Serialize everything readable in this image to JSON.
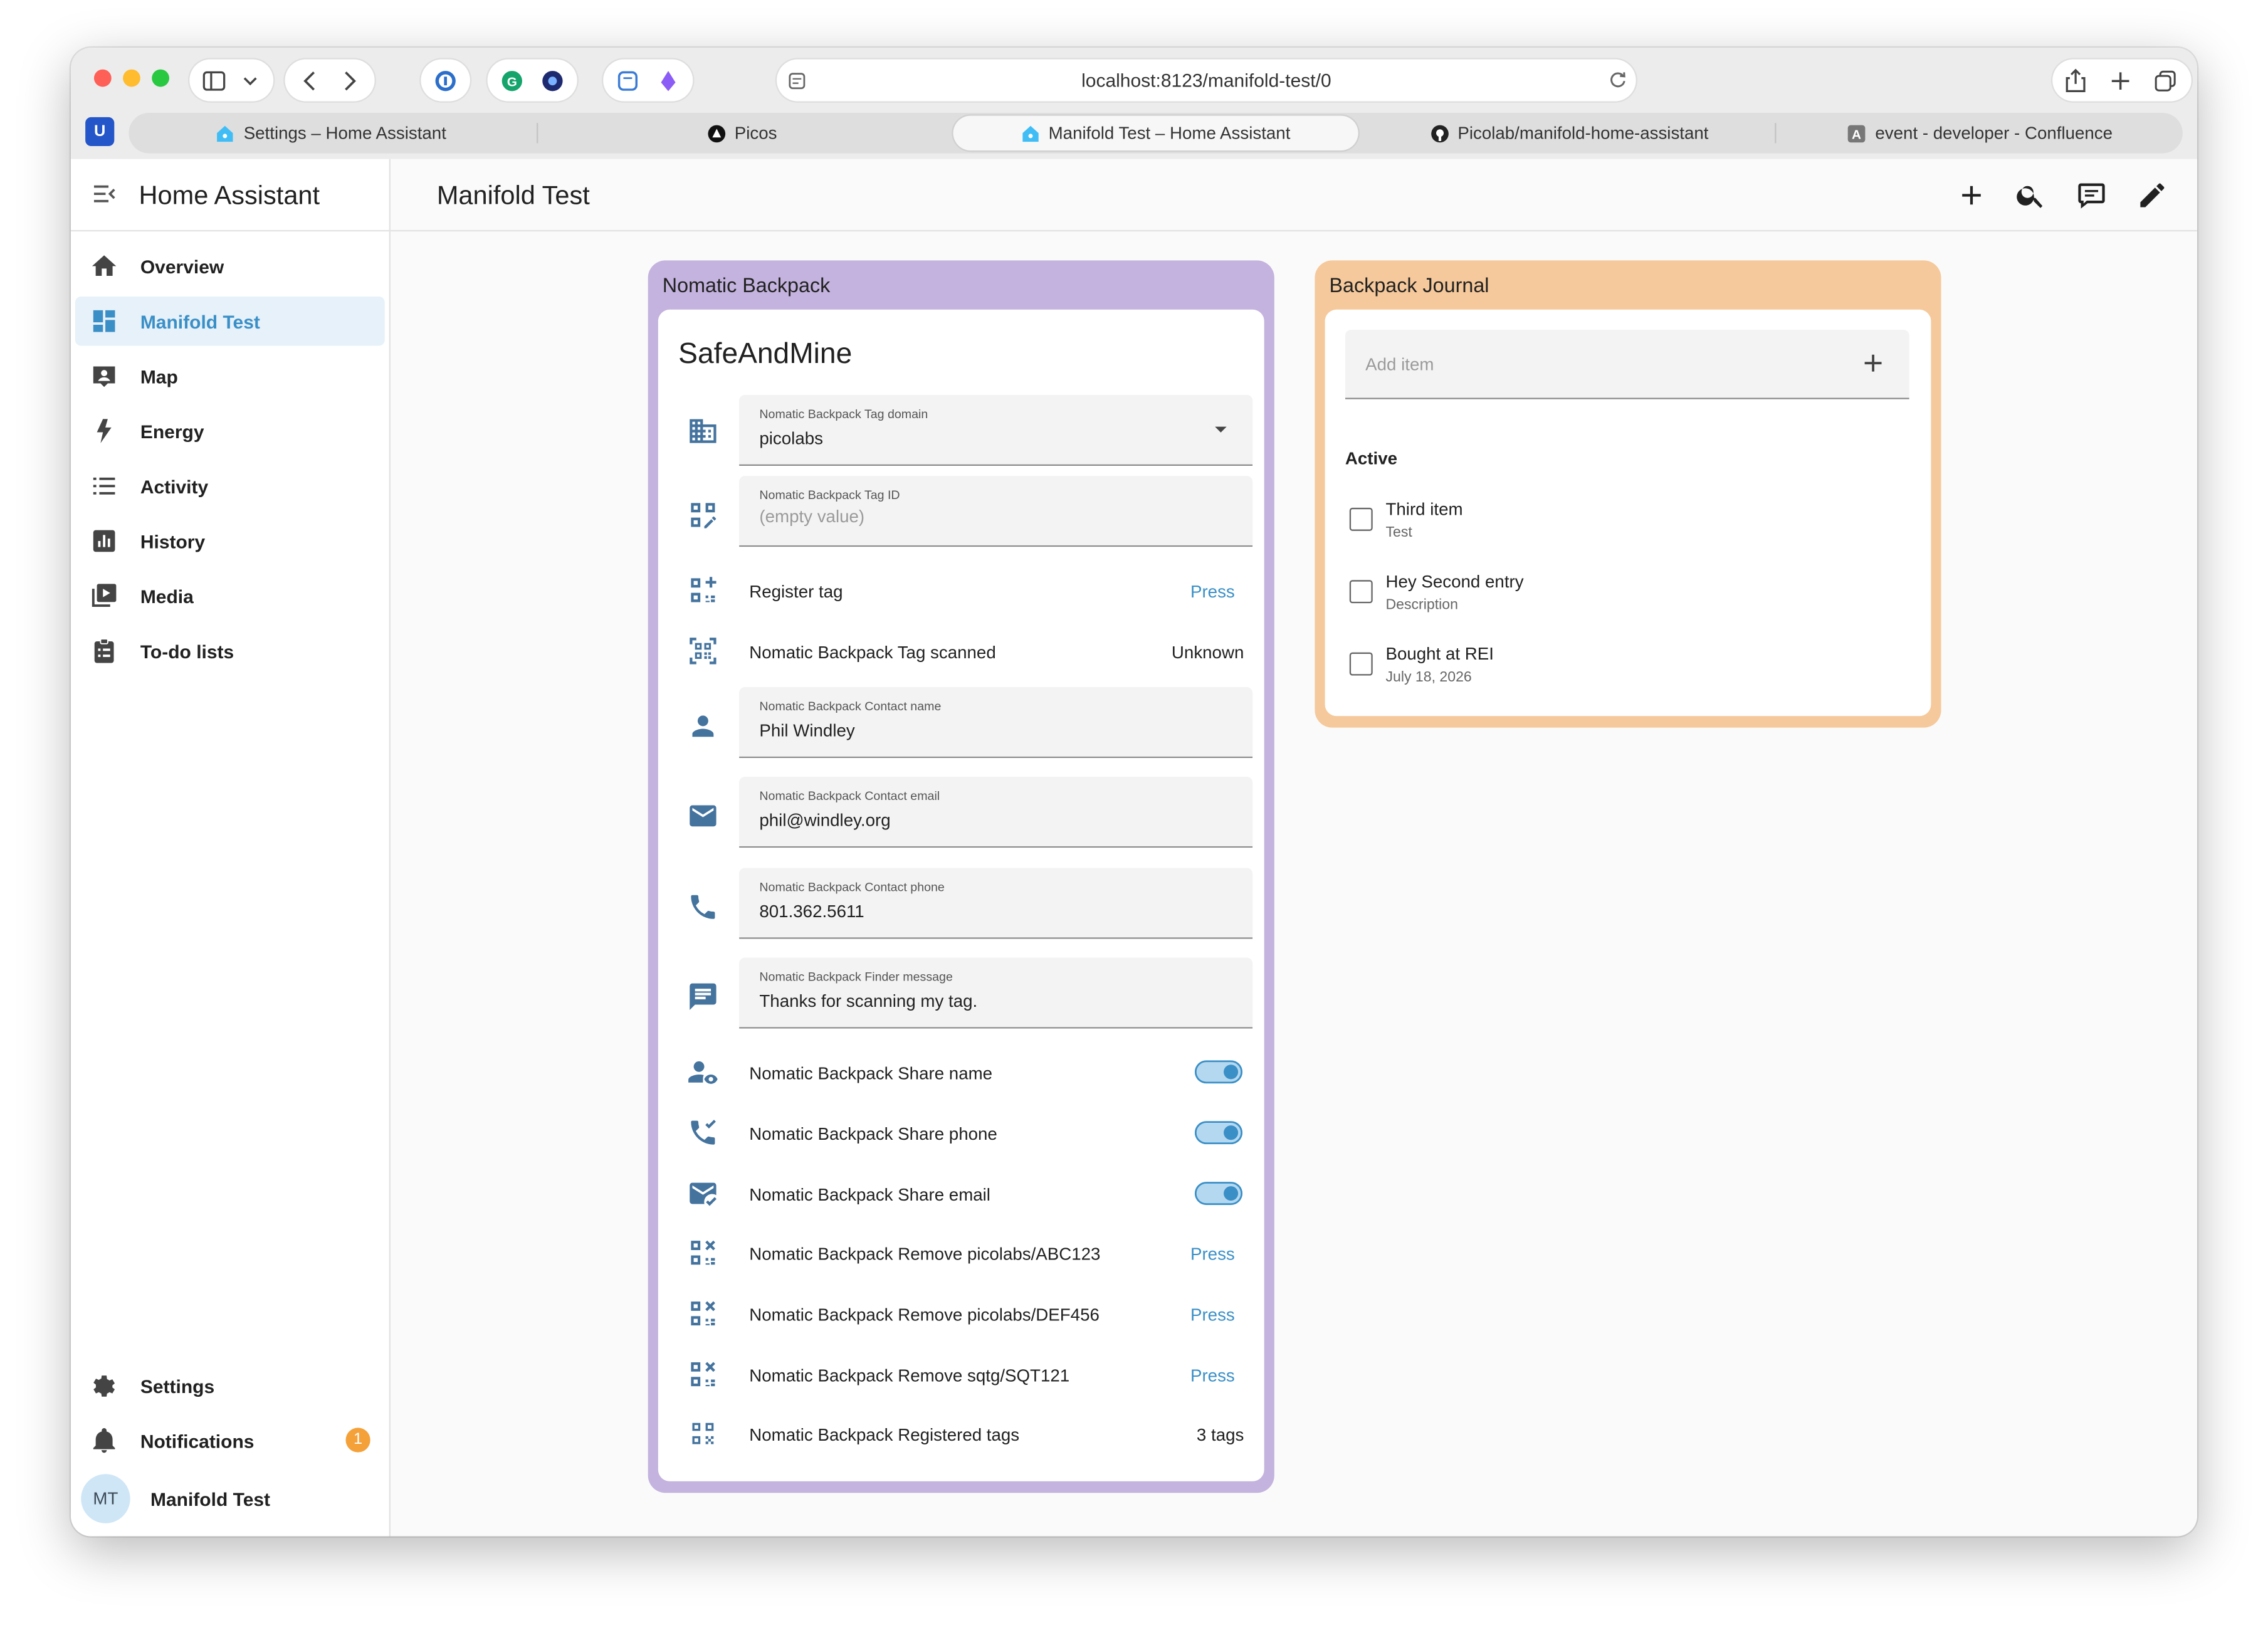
{
  "browser": {
    "url": "localhost:8123/manifold-test/0",
    "tabs": [
      {
        "title": "Settings – Home Assistant",
        "icon": "home-assistant-icon",
        "active": false
      },
      {
        "title": "Picos",
        "icon": "picos-icon",
        "active": false
      },
      {
        "title": "Manifold Test – Home Assistant",
        "icon": "home-assistant-icon",
        "active": true
      },
      {
        "title": "Picolab/manifold-home-assistant",
        "icon": "github-icon",
        "active": false
      },
      {
        "title": "event - developer - Confluence",
        "icon": "confluence-icon",
        "active": false
      }
    ]
  },
  "sidebar": {
    "title": "Home Assistant",
    "items": [
      {
        "label": "Overview",
        "icon": "home-icon"
      },
      {
        "label": "Manifold Test",
        "icon": "dashboard-icon",
        "active": true
      },
      {
        "label": "Map",
        "icon": "map-icon"
      },
      {
        "label": "Energy",
        "icon": "lightning-icon"
      },
      {
        "label": "Activity",
        "icon": "list-icon"
      },
      {
        "label": "History",
        "icon": "chart-icon"
      },
      {
        "label": "Media",
        "icon": "media-icon"
      },
      {
        "label": "To-do lists",
        "icon": "clipboard-list-icon"
      }
    ],
    "settings": "Settings",
    "notifications": "Notifications",
    "notifications_count": "1",
    "user_initials": "MT",
    "user_name": "Manifold Test"
  },
  "toolbar": {
    "title": "Manifold Test"
  },
  "backpack_card": {
    "title": "Nomatic Backpack",
    "heading": "SafeAndMine",
    "tag_domain": {
      "label": "Nomatic Backpack Tag domain",
      "value": "picolabs"
    },
    "tag_id": {
      "label": "Nomatic Backpack Tag ID",
      "placeholder": "(empty value)"
    },
    "register_tag": {
      "label": "Register tag",
      "action": "Press"
    },
    "tag_scanned": {
      "label": "Nomatic Backpack Tag scanned",
      "value": "Unknown"
    },
    "contact_name": {
      "label": "Nomatic Backpack Contact name",
      "value": "Phil Windley"
    },
    "contact_email": {
      "label": "Nomatic Backpack Contact email",
      "value": "phil@windley.org"
    },
    "contact_phone": {
      "label": "Nomatic Backpack Contact phone",
      "value": "801.362.5611"
    },
    "finder_message": {
      "label": "Nomatic Backpack Finder message",
      "value": "Thanks for scanning my tag."
    },
    "share_name": {
      "label": "Nomatic Backpack Share name",
      "on": true
    },
    "share_phone": {
      "label": "Nomatic Backpack Share phone",
      "on": true
    },
    "share_email": {
      "label": "Nomatic Backpack Share email",
      "on": true
    },
    "remove_1": {
      "label": "Nomatic Backpack Remove picolabs/ABC123",
      "action": "Press"
    },
    "remove_2": {
      "label": "Nomatic Backpack Remove picolabs/DEF456",
      "action": "Press"
    },
    "remove_3": {
      "label": "Nomatic Backpack Remove sqtg/SQT121",
      "action": "Press"
    },
    "registered_tags": {
      "label": "Nomatic Backpack Registered tags",
      "value": "3 tags"
    }
  },
  "journal_card": {
    "title": "Backpack Journal",
    "add_placeholder": "Add item",
    "section": "Active",
    "items": [
      {
        "name": "Third item",
        "desc": "Test"
      },
      {
        "name": "Hey Second entry",
        "desc": "Description"
      },
      {
        "name": "Bought at REI",
        "desc": "July 18, 2026"
      }
    ]
  },
  "colors": {
    "backpack_card": "#c3b3de",
    "journal_card": "#f5c99b",
    "accent": "#3a8fc7",
    "icon": "#44739e",
    "badge": "#f4a13a"
  }
}
